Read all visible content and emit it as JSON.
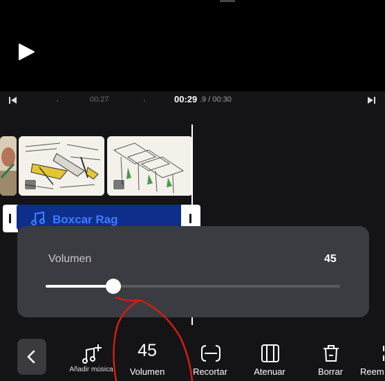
{
  "player": {
    "play_icon": "play-icon",
    "time_left": "00:27",
    "time_current": "00:29",
    "time_fraction": ".9",
    "time_total": "/ 00:30",
    "skip_start_icon": "skip-to-start-icon",
    "skip_end_icon": "skip-to-end-icon"
  },
  "timeline": {
    "clips": [
      {
        "type": "image",
        "icon": "image-icon"
      },
      {
        "type": "image",
        "icon": "image-icon"
      },
      {
        "type": "image",
        "icon": "image-icon"
      }
    ],
    "audio": {
      "title": "Boxcar Rag",
      "icon": "music-note-icon",
      "color": "#3e7bff",
      "background": "#0d2e8a"
    }
  },
  "volume_panel": {
    "label": "Volumen",
    "value": "45",
    "level": 0.23
  },
  "toolbar": {
    "back_icon": "chevron-left-icon",
    "items": [
      {
        "label": "Añadir música",
        "icon": "add-music-icon"
      },
      {
        "label": "Volumen",
        "value": "45"
      },
      {
        "label": "Recortar",
        "icon": "trim-icon"
      },
      {
        "label": "Atenuar",
        "icon": "fade-icon"
      },
      {
        "label": "Borrar",
        "icon": "trash-icon"
      },
      {
        "label": "Reem",
        "icon": "replace-icon"
      }
    ]
  },
  "colors": {
    "background": "#000000",
    "panel": "#3b3c41",
    "accent": "#3e7bff",
    "annotation": "#d21e10"
  }
}
